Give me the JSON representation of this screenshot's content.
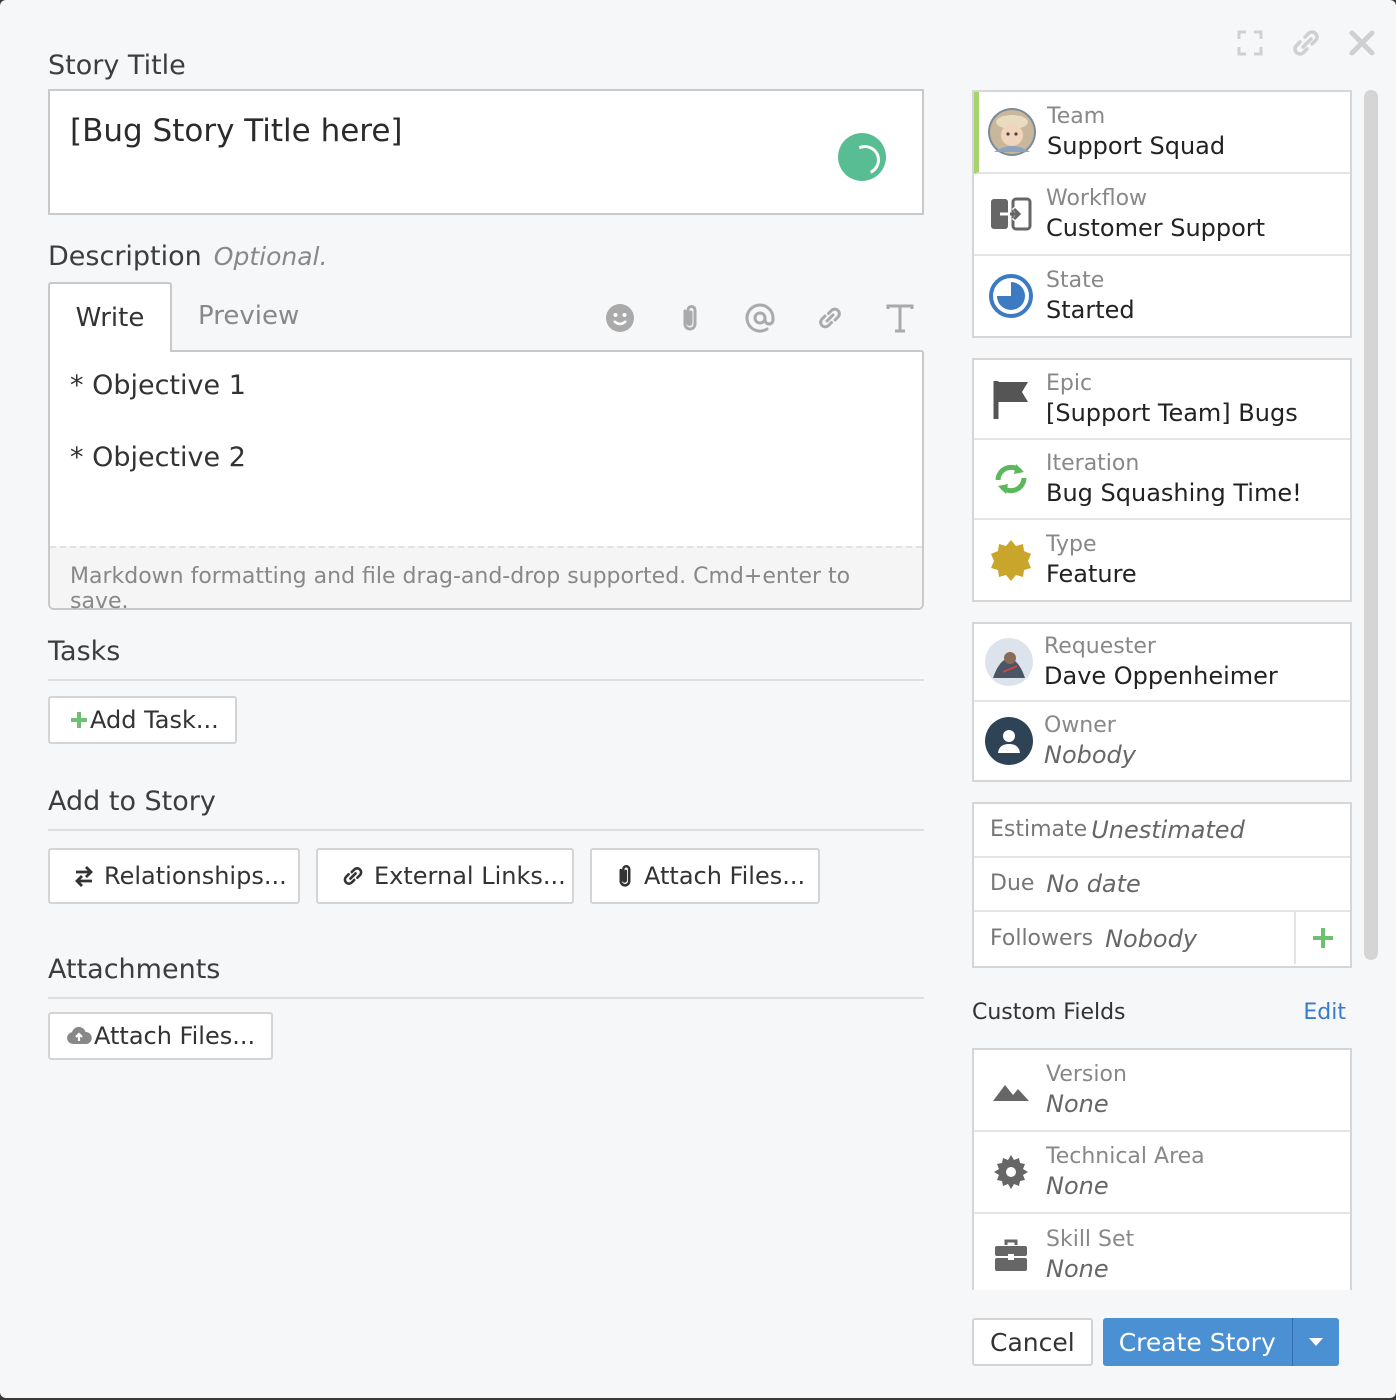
{
  "story_title": {
    "label": "Story Title",
    "value": "[Bug Story Title here]"
  },
  "description": {
    "label": "Description",
    "optional": "Optional.",
    "tabs": [
      "Write",
      "Preview"
    ],
    "toolbar_icons": [
      "emoji-icon",
      "paperclip-icon",
      "mention-icon",
      "link-icon",
      "text-format-icon"
    ],
    "lines": [
      "* Objective 1",
      "* Objective 2"
    ],
    "hint": "Markdown formatting and file drag-and-drop supported. Cmd+enter to save."
  },
  "tasks": {
    "label": "Tasks",
    "add_button": "Add Task..."
  },
  "add_to_story": {
    "label": "Add to Story",
    "buttons": [
      "Relationships...",
      "External Links...",
      "Attach Files..."
    ]
  },
  "attachments": {
    "label": "Attachments",
    "button": "Attach Files..."
  },
  "sidebar": {
    "team": {
      "label": "Team",
      "value": "Support Squad"
    },
    "workflow": {
      "label": "Workflow",
      "value": "Customer Support"
    },
    "state": {
      "label": "State",
      "value": "Started"
    },
    "epic": {
      "label": "Epic",
      "value": "[Support Team] Bugs"
    },
    "iteration": {
      "label": "Iteration",
      "value": "Bug Squashing Time!"
    },
    "type": {
      "label": "Type",
      "value": "Feature"
    },
    "requester": {
      "label": "Requester",
      "value": "Dave Oppenheimer"
    },
    "owner": {
      "label": "Owner",
      "value": "Nobody"
    },
    "estimate": {
      "label": "Estimate",
      "value": "Unestimated"
    },
    "due": {
      "label": "Due",
      "value": "No date"
    },
    "followers": {
      "label": "Followers",
      "value": "Nobody"
    }
  },
  "custom_fields": {
    "title": "Custom Fields",
    "edit": "Edit",
    "fields": [
      {
        "label": "Version",
        "value": "None"
      },
      {
        "label": "Technical Area",
        "value": "None"
      },
      {
        "label": "Skill Set",
        "value": "None"
      }
    ]
  },
  "footer": {
    "cancel": "Cancel",
    "create": "Create Story"
  },
  "colors": {
    "accent_green": "#a6d36c",
    "primary_blue": "#4a90d2",
    "spinner_green": "#58bd92",
    "state_blue": "#3c7bc1",
    "iteration_green": "#5cb85c",
    "type_gold": "#c9a52c"
  }
}
